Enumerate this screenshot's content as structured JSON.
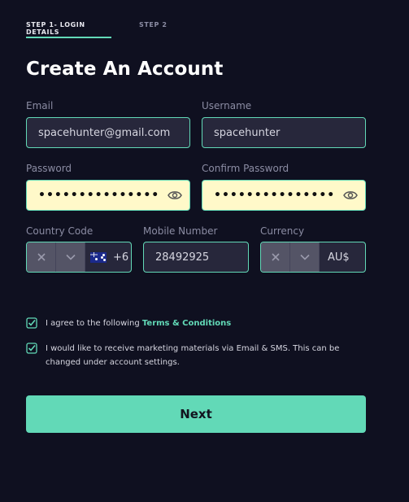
{
  "steps": {
    "active": "STEP 1- LOGIN DETAILS",
    "inactive": "STEP 2"
  },
  "title": "Create An Account",
  "email": {
    "label": "Email",
    "value": "spacehunter@gmail.com"
  },
  "username": {
    "label": "Username",
    "value": "spacehunter"
  },
  "password": {
    "label": "Password",
    "masked": "•••••••••••••••",
    "icon": "eye-icon"
  },
  "confirm_password": {
    "label": "Confirm Password",
    "masked": "•••••••••••••••",
    "icon": "eye-icon"
  },
  "country_code": {
    "label": "Country Code",
    "value": "+6",
    "flag": "australia-flag"
  },
  "mobile": {
    "label": "Mobile Number",
    "value": "28492925"
  },
  "currency": {
    "label": "Currency",
    "value": "AU$"
  },
  "agreements": {
    "terms_prefix": "I agree to the following ",
    "terms_link": "Terms & Conditions",
    "marketing": "I would like to receive marketing materials via Email & SMS. This can be changed under account settings."
  },
  "next_button": "Next",
  "colors": {
    "background": "#0f1020",
    "accent": "#62d9b7",
    "input_bg": "#27273b",
    "autofill_bg": "#fff9c9"
  }
}
